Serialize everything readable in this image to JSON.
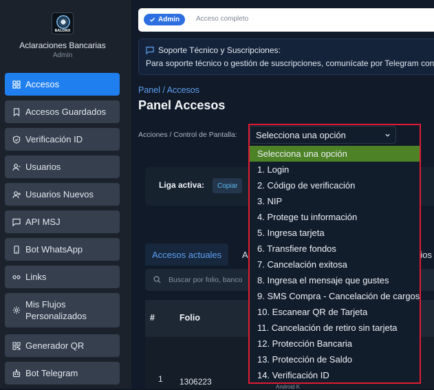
{
  "brand": {
    "logo_text": "BALONX",
    "title": "Aclaraciones Bancarias",
    "role": "Admin"
  },
  "sidebar": {
    "items": [
      {
        "label": "Accesos",
        "icon": "grid-icon"
      },
      {
        "label": "Accesos Guardados",
        "icon": "bookmark-icon"
      },
      {
        "label": "Verificación ID",
        "icon": "shield-icon"
      },
      {
        "label": "Usuarios",
        "icon": "user-icon"
      },
      {
        "label": "Usuarios Nuevos",
        "icon": "user-plus-icon"
      },
      {
        "label": "API MSJ",
        "icon": "message-icon"
      },
      {
        "label": "Bot WhatsApp",
        "icon": "phone-icon"
      },
      {
        "label": "Links",
        "icon": "link-icon"
      },
      {
        "label": "Mis Flujos Personalizados",
        "icon": "gear-icon"
      },
      {
        "label": "Generador QR",
        "icon": "qr-icon"
      },
      {
        "label": "Bot Telegram",
        "icon": "robot-icon"
      }
    ]
  },
  "admin_bar": {
    "badge": "Admin",
    "text": "Acceso completo"
  },
  "support": {
    "title": "Soporte Técnico y Suscripciones:",
    "body": "Para soporte técnico o gestión de suscripciones, comunícate por Telegram con @"
  },
  "breadcrumb": "Panel / Accesos",
  "page_title": "Panel Accesos",
  "control": {
    "label": "Acciones / Control de Pantalla:",
    "selected": "Selecciona una opción",
    "options": [
      "Selecciona una opción",
      "1. Login",
      "2. Código de verificación",
      "3. NIP",
      "4. Protege tu información",
      "5. Ingresa tarjeta",
      "6. Transfiere fondos",
      "7. Cancelación exitosa",
      "8. Ingresa el mensaje que gustes",
      "9. SMS Compra - Cancelación de cargos",
      "10. Escanear QR de Tarjeta",
      "11. Cancelación de retiro sin tarjeta",
      "12. Protección Bancaria",
      "13. Protección de Saldo",
      "14. Verificación ID"
    ]
  },
  "liga": {
    "label": "Liga activa:",
    "copy": "Copiar"
  },
  "tabs": {
    "active": "Accesos actuales",
    "second": "A",
    "third": "rios"
  },
  "search": {
    "placeholder": "Buscar por folio, banco"
  },
  "table": {
    "headers": {
      "num": "#",
      "folio": "Folio"
    },
    "rows": [
      {
        "num": "1",
        "folio": "1306223",
        "device": "Android K"
      }
    ]
  },
  "colors": {
    "accent": "#1f7fef",
    "highlight": "#e11b33",
    "selected_option": "#4d8226"
  }
}
